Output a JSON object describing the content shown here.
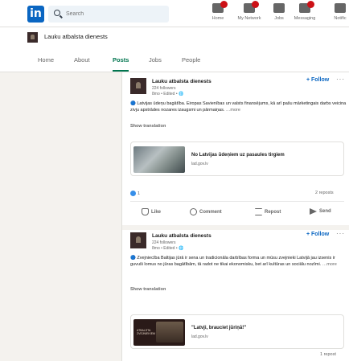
{
  "nav": {
    "search_placeholder": "Search",
    "items": [
      {
        "label": "Home",
        "icon": "home-icon"
      },
      {
        "label": "My Network",
        "icon": "network-icon"
      },
      {
        "label": "Jobs",
        "icon": "jobs-icon"
      },
      {
        "label": "Messaging",
        "icon": "messaging-icon"
      },
      {
        "label": "Notific",
        "icon": "bell-icon"
      }
    ],
    "brand_color": "#0a66c2",
    "badge_color": "#cc1016"
  },
  "company": {
    "name": "Lauku atbalsta dienests",
    "tabs": [
      {
        "label": "Home"
      },
      {
        "label": "About"
      },
      {
        "label": "Posts",
        "active": true
      },
      {
        "label": "Jobs"
      },
      {
        "label": "People"
      }
    ],
    "accent_color": "#01754f"
  },
  "posts": [
    {
      "author": "Lauku atbalsta dienests",
      "followers": "224 followers",
      "meta": "8mo • Edited • 🌐",
      "follow_label": "+ Follow",
      "more": "···",
      "text": "🔵 Latvijas ūdeņu bagātība. Eiropas Savienības un valsts finansējums, kā arī pašu mārketingais darbs veicina zivju apstrādes nozares izaugsmi un pārmaiņas.",
      "more_link": "…more",
      "show_translation": "Show translation",
      "link_title": "No Latvijas ūdeņiem uz pasaules tirgiem",
      "link_domain": "lad.gov.lv",
      "reactions": "1",
      "reposts": "2 reposts",
      "actions": {
        "like": "Like",
        "comment": "Comment",
        "repost": "Repost",
        "send": "Send"
      }
    },
    {
      "author": "Lauku atbalsta dienests",
      "followers": "224 followers",
      "meta": "8mo • Edited • 🌐",
      "follow_label": "+ Follow",
      "more": "···",
      "text": "🔵 Zvejniecība Baltijas jūrā ir sena un tradicionāla darbības forma un mūsu zvejnieki Latvijā jau izsenis ir guvuši lomus no jūras bagātībām, tā radot ne tikai ekonomisku, bet arī kultūras un sociālu nozīmi.",
      "more_link": "…more",
      "show_translation": "Show translation",
      "link_title": "\"Latvji, brauciet jūriņā!\"",
      "link_domain": "lad.gov.lv",
      "thumb_caption": "ATBALSTA\nZVEJNIEKIEM",
      "reposts": "1 repost"
    }
  ]
}
